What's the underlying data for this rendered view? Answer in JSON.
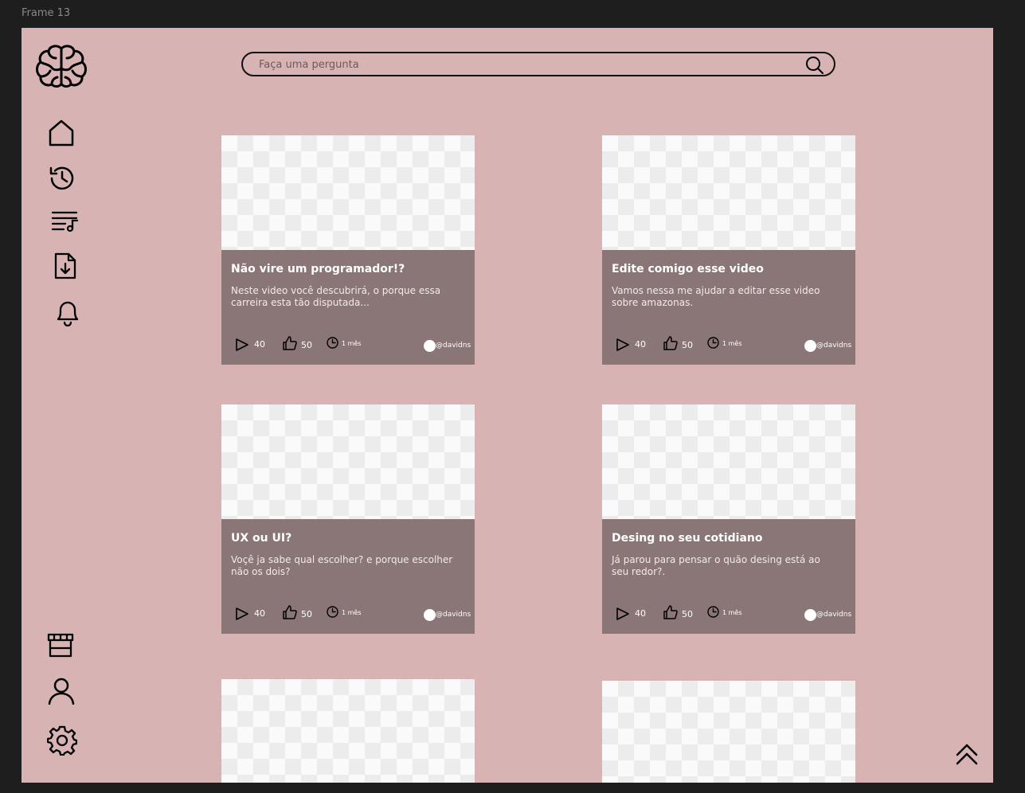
{
  "frame": {
    "label": "Frame 13"
  },
  "search": {
    "placeholder": "Faça uma pergunta"
  },
  "sidebar": {
    "logo": "brain-icon",
    "top_items": [
      "home-icon",
      "history-icon",
      "playlist-icon",
      "download-icon",
      "bell-icon"
    ],
    "bottom_items": [
      "store-icon",
      "user-icon",
      "settings-icon"
    ]
  },
  "cards": [
    {
      "title": "Não vire um programador!?",
      "description": "Neste video você descubrirá, o porque essa carreira esta tão disputada...",
      "views": "40",
      "likes": "50",
      "time": "1 mês",
      "author": "@davidns"
    },
    {
      "title": "Edite comigo esse video",
      "description": "Vamos nessa me ajudar a editar esse video sobre amazonas.",
      "views": "40",
      "likes": "50",
      "time": "1 mês",
      "author": "@davidns"
    },
    {
      "title": "UX ou UI?",
      "description": "Voçê ja sabe qual escolher? e porque escolher não os dois?",
      "views": "40",
      "likes": "50",
      "time": "1 mês",
      "author": "@davidns"
    },
    {
      "title": "Desing no seu cotidiano",
      "description": "Já parou para pensar o quão desing está ao seu redor?.",
      "views": "40",
      "likes": "50",
      "time": "1 mês",
      "author": "@davidns"
    }
  ],
  "scroll_top": "chevrons-up-icon",
  "colors": {
    "frame_bg": "#d8b3b3",
    "card_bg": "#8a7676",
    "canvas_bg": "#1e1e1e"
  }
}
